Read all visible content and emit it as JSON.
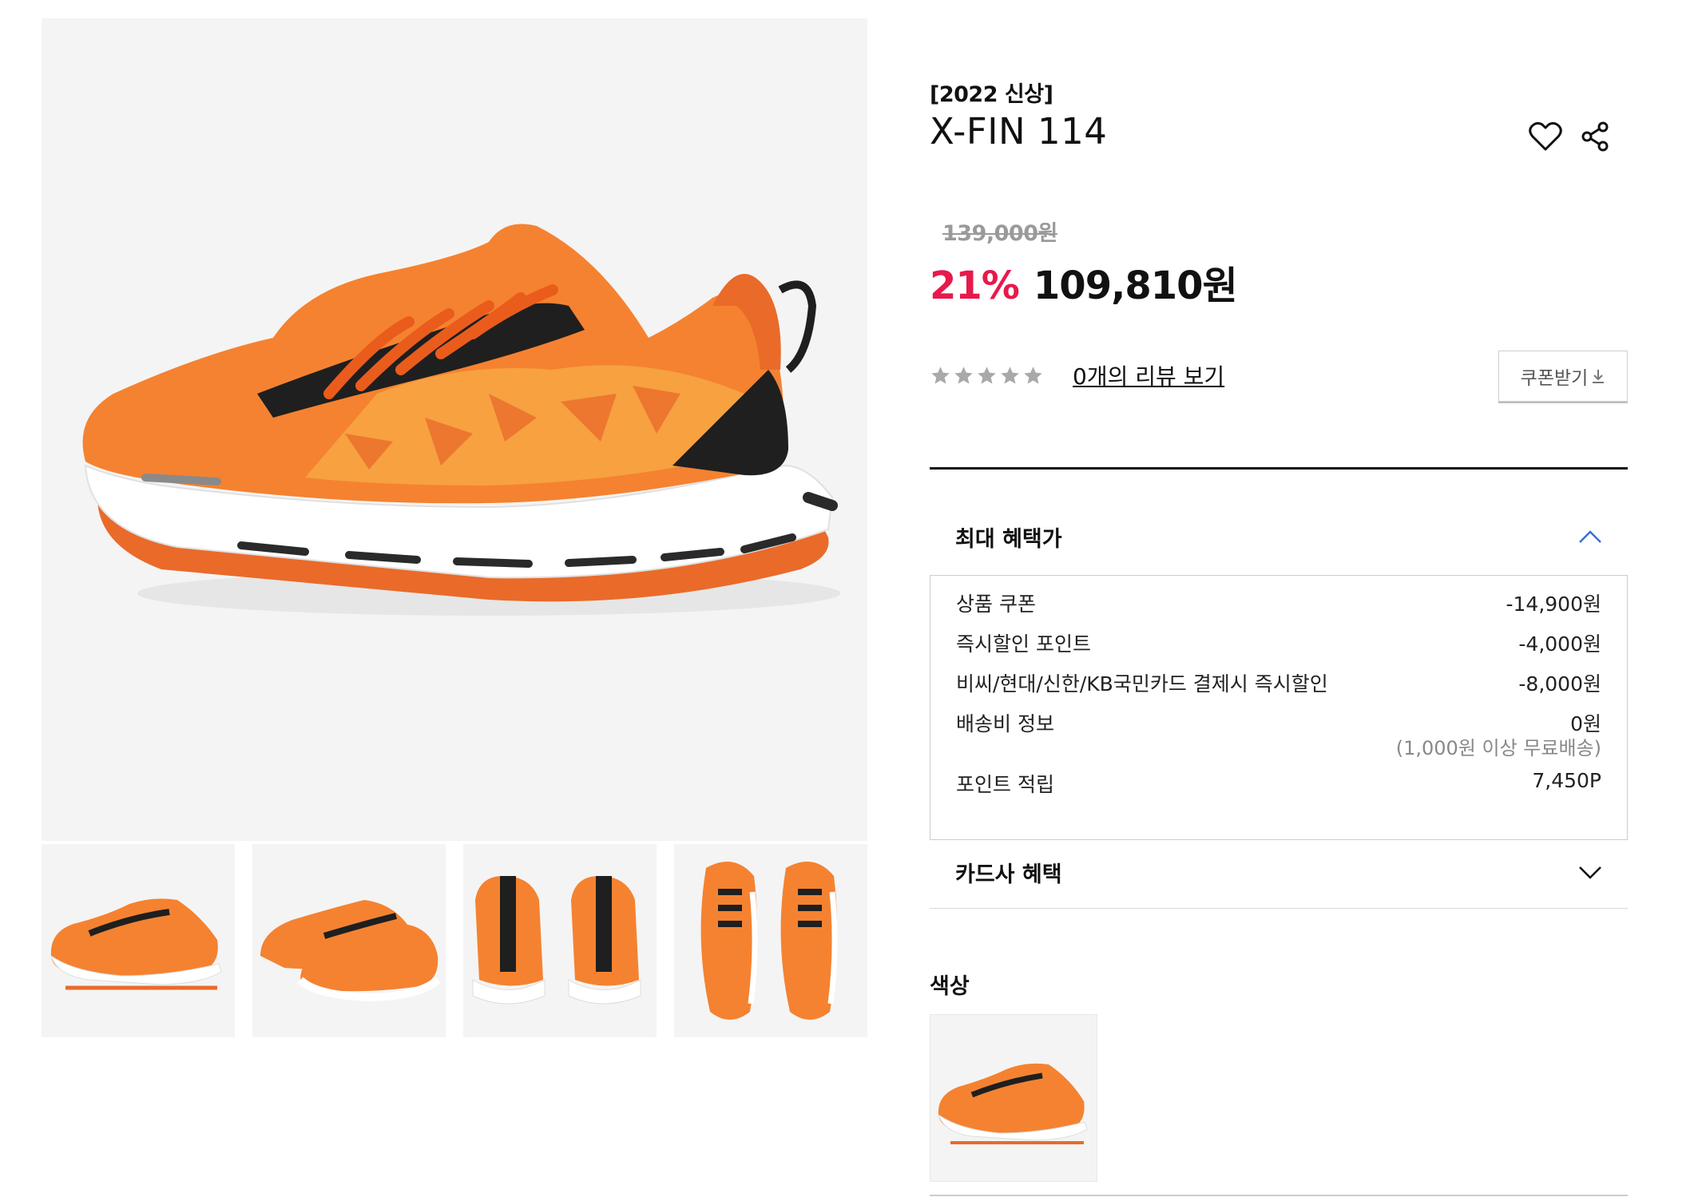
{
  "product": {
    "tag": "[2022 신상]",
    "title": "X-FIN 114",
    "original_price": "139,000원",
    "discount_rate": "21%",
    "sale_price": "109,810원"
  },
  "review": {
    "rating": 0,
    "link_label": "0개의 리뷰 보기"
  },
  "coupon_button": {
    "label": "쿠폰받기",
    "icon": "download-icon"
  },
  "benefits": {
    "title": "최대 혜택가",
    "rows": [
      {
        "label": "상품 쿠폰",
        "value": "-14,900원"
      },
      {
        "label": "즉시할인 포인트",
        "value": "-4,000원"
      },
      {
        "label": "비씨/현대/신한/KB국민카드 결제시 즉시할인",
        "value": "-8,000원"
      },
      {
        "label": "배송비 정보",
        "value": "0원",
        "sub": "(1,000원 이상 무료배송)"
      },
      {
        "label": "포인트 적립",
        "value": "7,450P"
      }
    ]
  },
  "card_benefits": {
    "title": "카드사 혜택"
  },
  "color_section": {
    "label": "색상"
  },
  "colors": {
    "accent": "#e8194b",
    "shoe_orange": "#f07a2a",
    "chevron_blue": "#3a6fd8"
  },
  "icons": [
    "heart-icon",
    "share-icon",
    "star-icon",
    "download-icon",
    "chevron-up-icon",
    "chevron-down-icon"
  ]
}
